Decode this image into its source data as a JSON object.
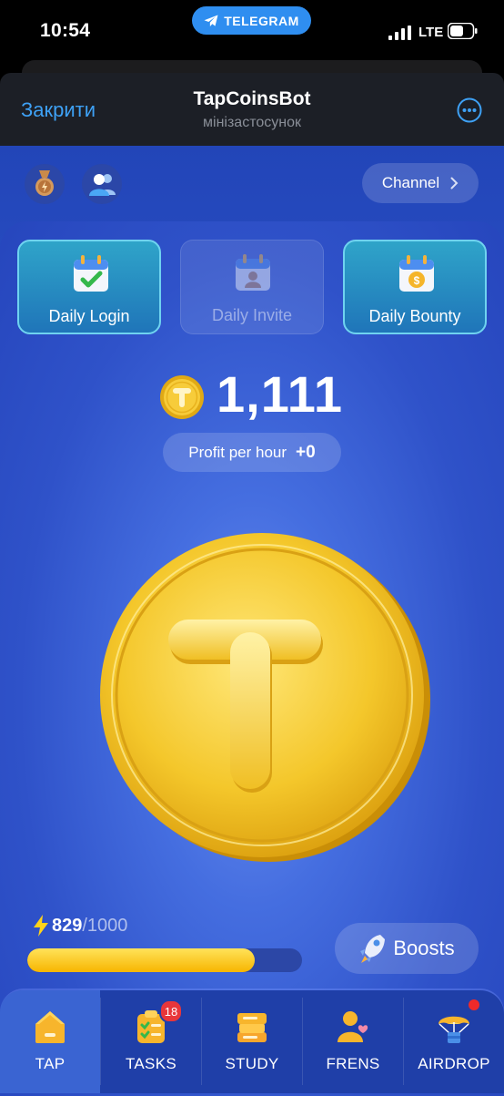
{
  "status_bar": {
    "time": "10:54",
    "pill": "TELEGRAM",
    "network": "LTE"
  },
  "header": {
    "close": "Закрити",
    "title": "TapCoinsBot",
    "subtitle": "мінізастосунок"
  },
  "top_bar": {
    "channel": "Channel"
  },
  "daily": [
    {
      "label": "Daily Login",
      "icon": "calendar-check-icon",
      "state": "active"
    },
    {
      "label": "Daily Invite",
      "icon": "calendar-person-icon",
      "state": "inactive"
    },
    {
      "label": "Daily Bounty",
      "icon": "calendar-coin-icon",
      "state": "active"
    }
  ],
  "balance": {
    "value": "1,111",
    "profit_label": "Profit per hour",
    "profit_value": "+0"
  },
  "energy": {
    "current": "829",
    "max": "/1000",
    "fill_fraction": 0.829
  },
  "boosts": {
    "label": "Boosts"
  },
  "nav": {
    "tap": "TAP",
    "tasks": "TASKS",
    "tasks_badge": "18",
    "study": "STUDY",
    "frens": "FRENS",
    "airdrop": "AIRDROP"
  },
  "colors": {
    "accent_link": "#3ea1f5",
    "coin_gold": "#f5c521",
    "app_blue": "#2f52c9",
    "energy_fill": "#f7b500"
  }
}
